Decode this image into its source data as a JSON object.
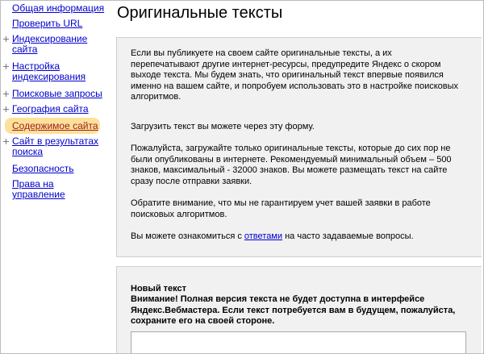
{
  "sidebar": {
    "items": [
      {
        "label": "Общая информация",
        "expandable": false,
        "active": false
      },
      {
        "label": "Проверить URL",
        "expandable": false,
        "active": false
      },
      {
        "label": "Индексирование\nсайта",
        "expandable": true,
        "active": false
      },
      {
        "label": "Настройка\nиндексирования",
        "expandable": true,
        "active": false
      },
      {
        "label": "Поисковые запросы",
        "expandable": true,
        "active": false
      },
      {
        "label": "География сайта",
        "expandable": true,
        "active": false
      },
      {
        "label": "Содержимое сайта",
        "expandable": false,
        "active": true
      },
      {
        "label": "Сайт в результатах\nпоиска",
        "expandable": true,
        "active": false
      },
      {
        "label": "Безопасность",
        "expandable": false,
        "active": false
      },
      {
        "label": "Права на\nуправление",
        "expandable": false,
        "active": false
      }
    ]
  },
  "main": {
    "title": "Оригинальные тексты",
    "info": {
      "paragraph1": "Если вы публикуете на своем сайте оригинальные тексты, а их перепечатывают другие интернет-ресурсы, предупредите Яндекс о скором выходе текста. Мы будем знать, что оригинальный текст впервые появился именно на вашем сайте, и попробуем использовать это в настройке поисковых алгоритмов.",
      "paragraph2": "Загрузить текст вы можете через эту форму.",
      "paragraph3": "Пожалуйста, загружайте только оригинальные тексты, которые до сих пор не были опубликованы в интернете. Рекомендуемый минимальный объем – 500 знаков, максимальный - 32000 знаков. Вы можете размещать текст на сайте сразу после отправки заявки.",
      "paragraph4": "Обратите внимание, что мы не гарантируем учет вашей заявки в работе поисковых алгоритмов.",
      "paragraph5_before": "Вы можете ознакомиться с ",
      "paragraph5_link": "ответами",
      "paragraph5_after": " на часто задаваемые вопросы."
    },
    "new_text": {
      "title": "Новый текст",
      "warning": "Внимание! Полная версия текста не будет доступна в интерфейсе Яндекс.Вебмастера. Если текст потребуется вам в будущем, пожалуйста, сохраните его на своей стороне.",
      "textarea_value": ""
    }
  },
  "colors": {
    "link": "#0000cc",
    "active_link": "#9b1c1c",
    "active_highlight": "#fde19a",
    "panel_background": "#f1f1f1"
  }
}
